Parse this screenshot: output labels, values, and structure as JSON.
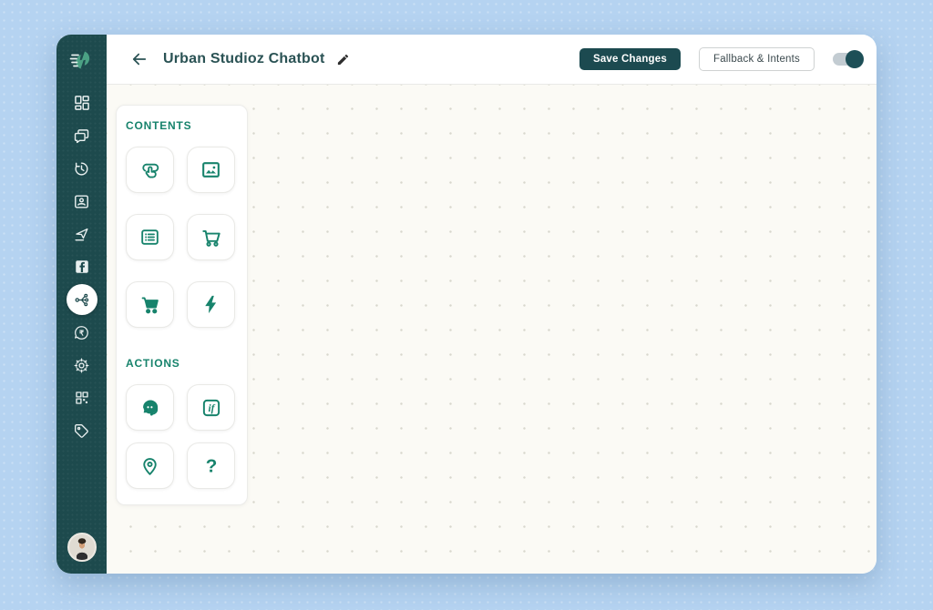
{
  "header": {
    "title": "Urban Studioz Chatbot",
    "back_icon": "arrow-left",
    "edit_icon": "pencil",
    "save_button": "Save Changes",
    "fallback_button": "Fallback & Intents",
    "toggle_state": "on"
  },
  "sidebar": {
    "logo_icon": "spark-swirl-logo",
    "rupee_glyph": "₹",
    "items": [
      {
        "icon": "dashboard-icon",
        "active": false
      },
      {
        "icon": "conversations-icon",
        "active": false
      },
      {
        "icon": "history-icon",
        "active": false
      },
      {
        "icon": "contacts-icon",
        "active": false
      },
      {
        "icon": "send-icon",
        "active": false
      },
      {
        "icon": "facebook-icon",
        "active": false
      },
      {
        "icon": "flow-builder-icon",
        "active": true
      },
      {
        "icon": "payments-icon",
        "active": false
      },
      {
        "icon": "settings-icon",
        "active": false
      },
      {
        "icon": "widgets-icon",
        "active": false
      },
      {
        "icon": "tags-icon",
        "active": false
      }
    ],
    "avatar": "user-profile-photo"
  },
  "palette": {
    "contents": {
      "label": "CONTENTS",
      "items": [
        "button-block",
        "image-block",
        "list-block",
        "cart-block",
        "cart-filled-block",
        "flash-block"
      ]
    },
    "actions": {
      "label": "ACTIONS",
      "items": [
        "agent-handover",
        "condition-if",
        "location",
        "question"
      ],
      "if_glyph": "if",
      "question_glyph": "?"
    }
  },
  "colors": {
    "page_bg": "#b5d3f1",
    "sidebar_bg": "#1d4a4d",
    "accent_green": "#17836c",
    "dark_teal": "#1c4a50",
    "canvas_bg": "#fbfaf5"
  }
}
